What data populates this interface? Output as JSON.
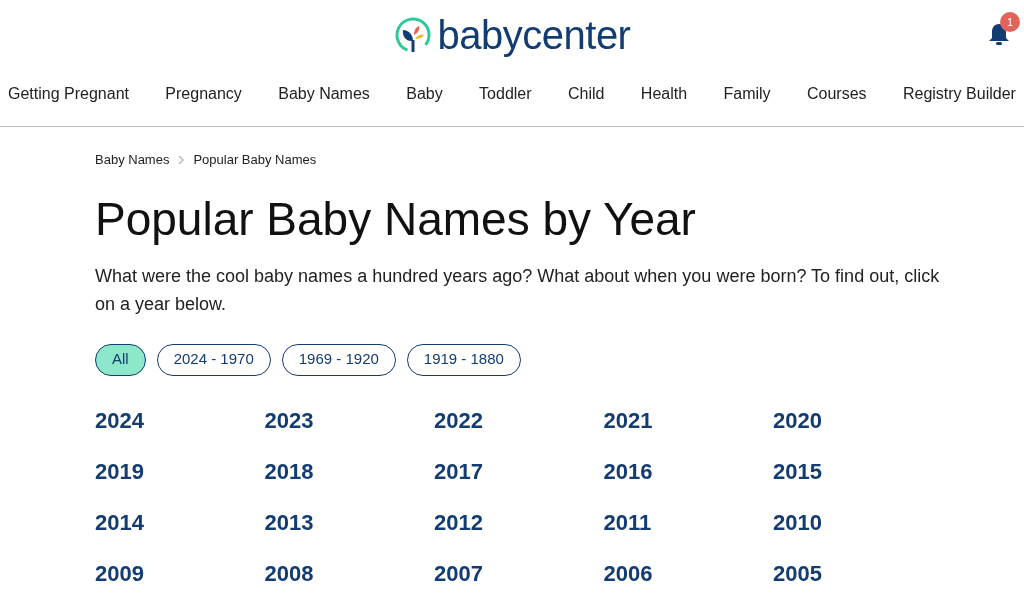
{
  "header": {
    "logo_text": "babycenter",
    "notification_count": "1"
  },
  "nav": [
    "Getting Pregnant",
    "Pregnancy",
    "Baby Names",
    "Baby",
    "Toddler",
    "Child",
    "Health",
    "Family",
    "Courses",
    "Registry Builder"
  ],
  "breadcrumb": [
    "Baby Names",
    "Popular Baby Names"
  ],
  "title": "Popular Baby Names by Year",
  "intro": "What were the cool baby names a hundred years ago? What about when you were born? To find out, click on a year below.",
  "filters": [
    {
      "label": "All",
      "selected": true
    },
    {
      "label": "2024 - 1970",
      "selected": false
    },
    {
      "label": "1969 - 1920",
      "selected": false
    },
    {
      "label": "1919 - 1880",
      "selected": false
    }
  ],
  "years": [
    "2024",
    "2023",
    "2022",
    "2021",
    "2020",
    "2019",
    "2018",
    "2017",
    "2016",
    "2015",
    "2014",
    "2013",
    "2012",
    "2011",
    "2010",
    "2009",
    "2008",
    "2007",
    "2006",
    "2005"
  ]
}
